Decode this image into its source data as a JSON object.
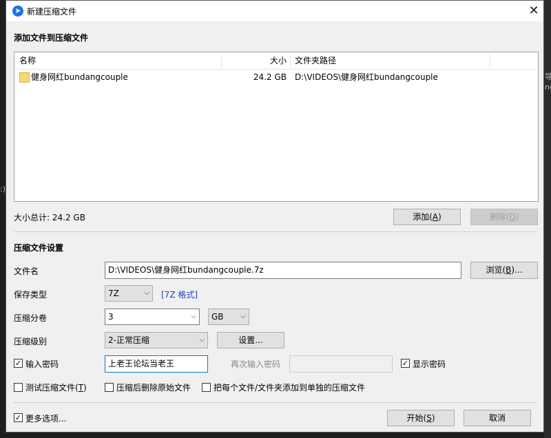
{
  "window": {
    "title": "新建压缩文件",
    "close_label": "✕",
    "app_icon_glyph": "➤"
  },
  "files_section": {
    "title": "添加文件到压缩文件",
    "columns": {
      "name": "名称",
      "size": "大小",
      "path": "文件夹路径"
    },
    "rows": [
      {
        "name": "健身网红bundangcouple",
        "size": "24.2 GB",
        "path": "D:\\VIDEOS\\健身网红bundangcouple"
      }
    ],
    "total": "大小总计: 24.2 GB",
    "add_button": {
      "text": "添加(",
      "key": "A",
      "end": ")"
    },
    "delete_button": {
      "text": "删除(",
      "key": "D",
      "end": ")"
    }
  },
  "settings": {
    "title": "压缩文件设置",
    "filename_label": "文件名",
    "filename_value": "D:\\VIDEOS\\健身网红bundangcouple.7z",
    "browse_button": {
      "text": "浏览(",
      "key": "B",
      "end": ")..."
    },
    "save_type_label": "保存类型",
    "save_type_value": "7Z",
    "format_link": "[7Z 格式]",
    "split_label": "压缩分卷",
    "split_value": "3",
    "split_unit": "GB",
    "level_label": "压缩级别",
    "level_value": "2-正常压缩",
    "settings_button": "设置...",
    "password_label": "输入密码",
    "password_value": "上老王论坛当老王",
    "reenter_label": "再次输入密码",
    "show_password_label": "显示密码",
    "test_label": {
      "text": "测试压缩文件(",
      "key": "T",
      "end": ")"
    },
    "delete_source_label": "压缩后删除原始文件",
    "each_file_label": "把每个文件/文件夹添加到单独的压缩文件"
  },
  "footer": {
    "more_options_label": "更多选项...",
    "start_button": {
      "text": "开始(",
      "key": "S",
      "end": ")"
    },
    "cancel_button": "取消"
  },
  "background": {
    "text1": "导",
    "text2": "ng",
    "text3": ":)"
  }
}
